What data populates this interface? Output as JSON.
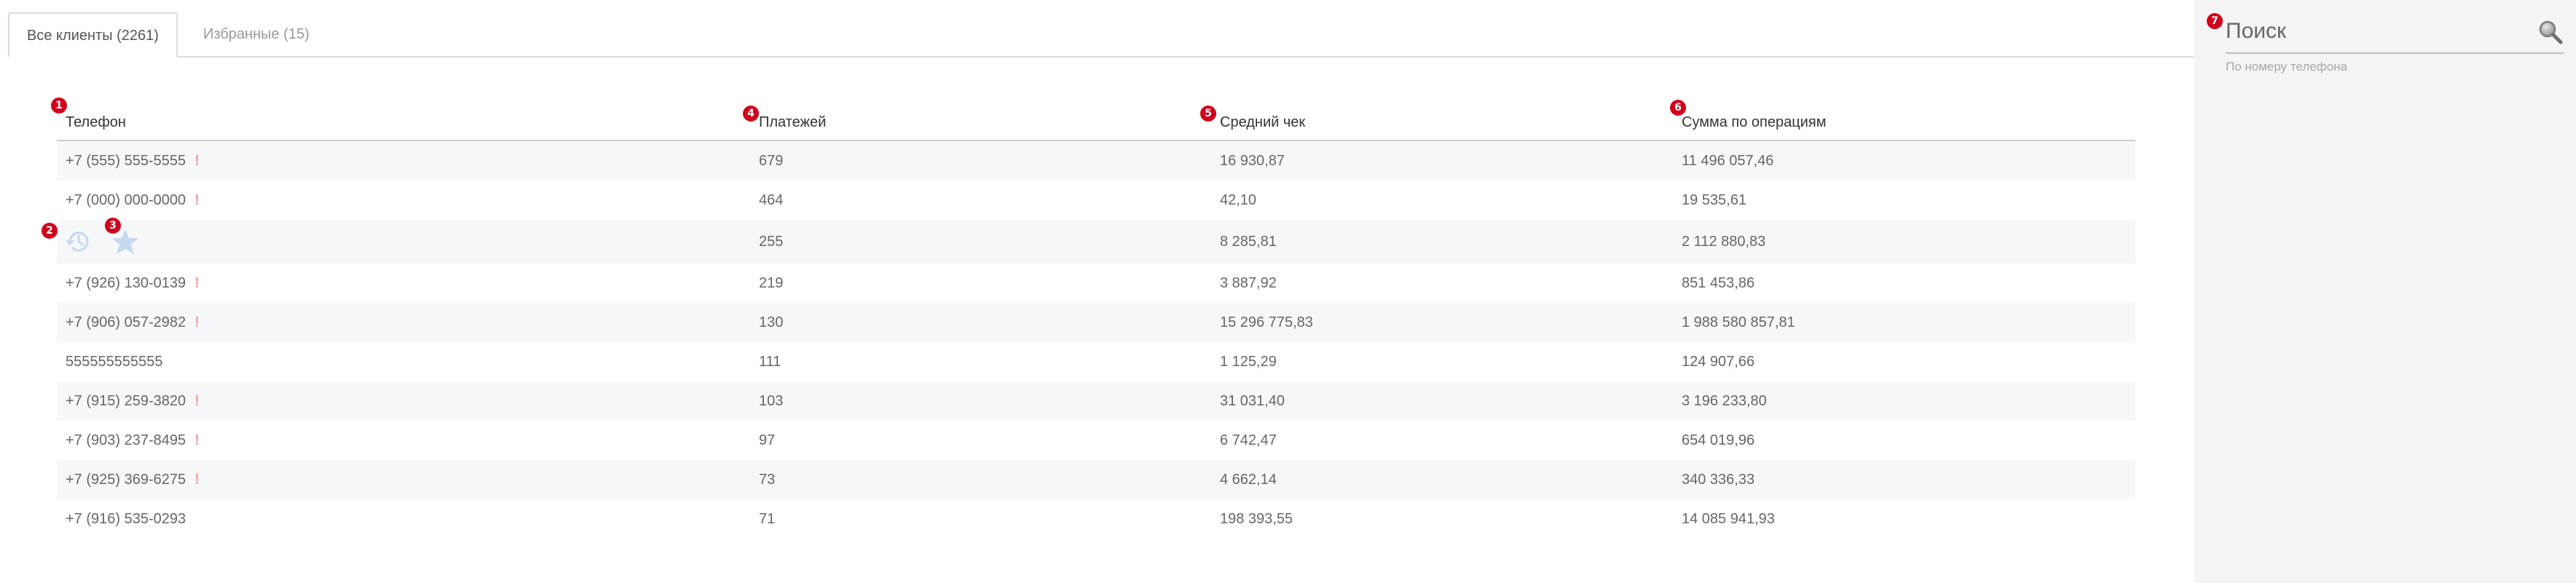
{
  "tabs": {
    "all_clients": "Все клиенты (2261)",
    "favorites": "Избранные (15)"
  },
  "table": {
    "headers": {
      "phone": "Телефон",
      "payments": "Платежей",
      "avg_check": "Средний чек",
      "sum": "Сумма по операциям"
    },
    "rows": [
      {
        "phone": "+7 (555) 555-5555",
        "flag": "!",
        "payments": "679",
        "avg_check": "16 930,87",
        "sum": "11 496 057,46"
      },
      {
        "phone": "+7 (000) 000-0000",
        "flag": "!",
        "payments": "464",
        "avg_check": "42,10",
        "sum": "19 535,61"
      },
      {
        "phone": "",
        "flag": "",
        "payments": "255",
        "avg_check": "8 285,81",
        "sum": "2 112 880,83"
      },
      {
        "phone": "+7 (926) 130-0139",
        "flag": "!",
        "payments": "219",
        "avg_check": "3 887,92",
        "sum": "851 453,86"
      },
      {
        "phone": "+7 (906) 057-2982",
        "flag": "!",
        "payments": "130",
        "avg_check": "15 296 775,83",
        "sum": "1 988 580 857,81"
      },
      {
        "phone": "555555555555",
        "flag": "",
        "payments": "111",
        "avg_check": "1 125,29",
        "sum": "124 907,66"
      },
      {
        "phone": "+7 (915) 259-3820",
        "flag": "!",
        "payments": "103",
        "avg_check": "31 031,40",
        "sum": "3 196 233,80"
      },
      {
        "phone": "+7 (903) 237-8495",
        "flag": "!",
        "payments": "97",
        "avg_check": "6 742,47",
        "sum": "654 019,96"
      },
      {
        "phone": "+7 (925) 369-6275",
        "flag": "!",
        "payments": "73",
        "avg_check": "4 662,14",
        "sum": "340 336,33"
      },
      {
        "phone": "+7 (916) 535-0293",
        "flag": "",
        "payments": "71",
        "avg_check": "198 393,55",
        "sum": "14 085 941,93"
      }
    ],
    "row_icons": [
      "history-icon",
      "star-icon"
    ]
  },
  "badges": [
    "1",
    "2",
    "3",
    "4",
    "5",
    "6",
    "7"
  ],
  "search": {
    "placeholder": "Поиск",
    "hint": "По номеру телефона",
    "icon": "search-icon"
  },
  "colors": {
    "badge": "#d0021b",
    "flag": "#f0a3a3",
    "row_icon": "#c7d9ee",
    "sidebar_bg": "#f4f4f4"
  }
}
